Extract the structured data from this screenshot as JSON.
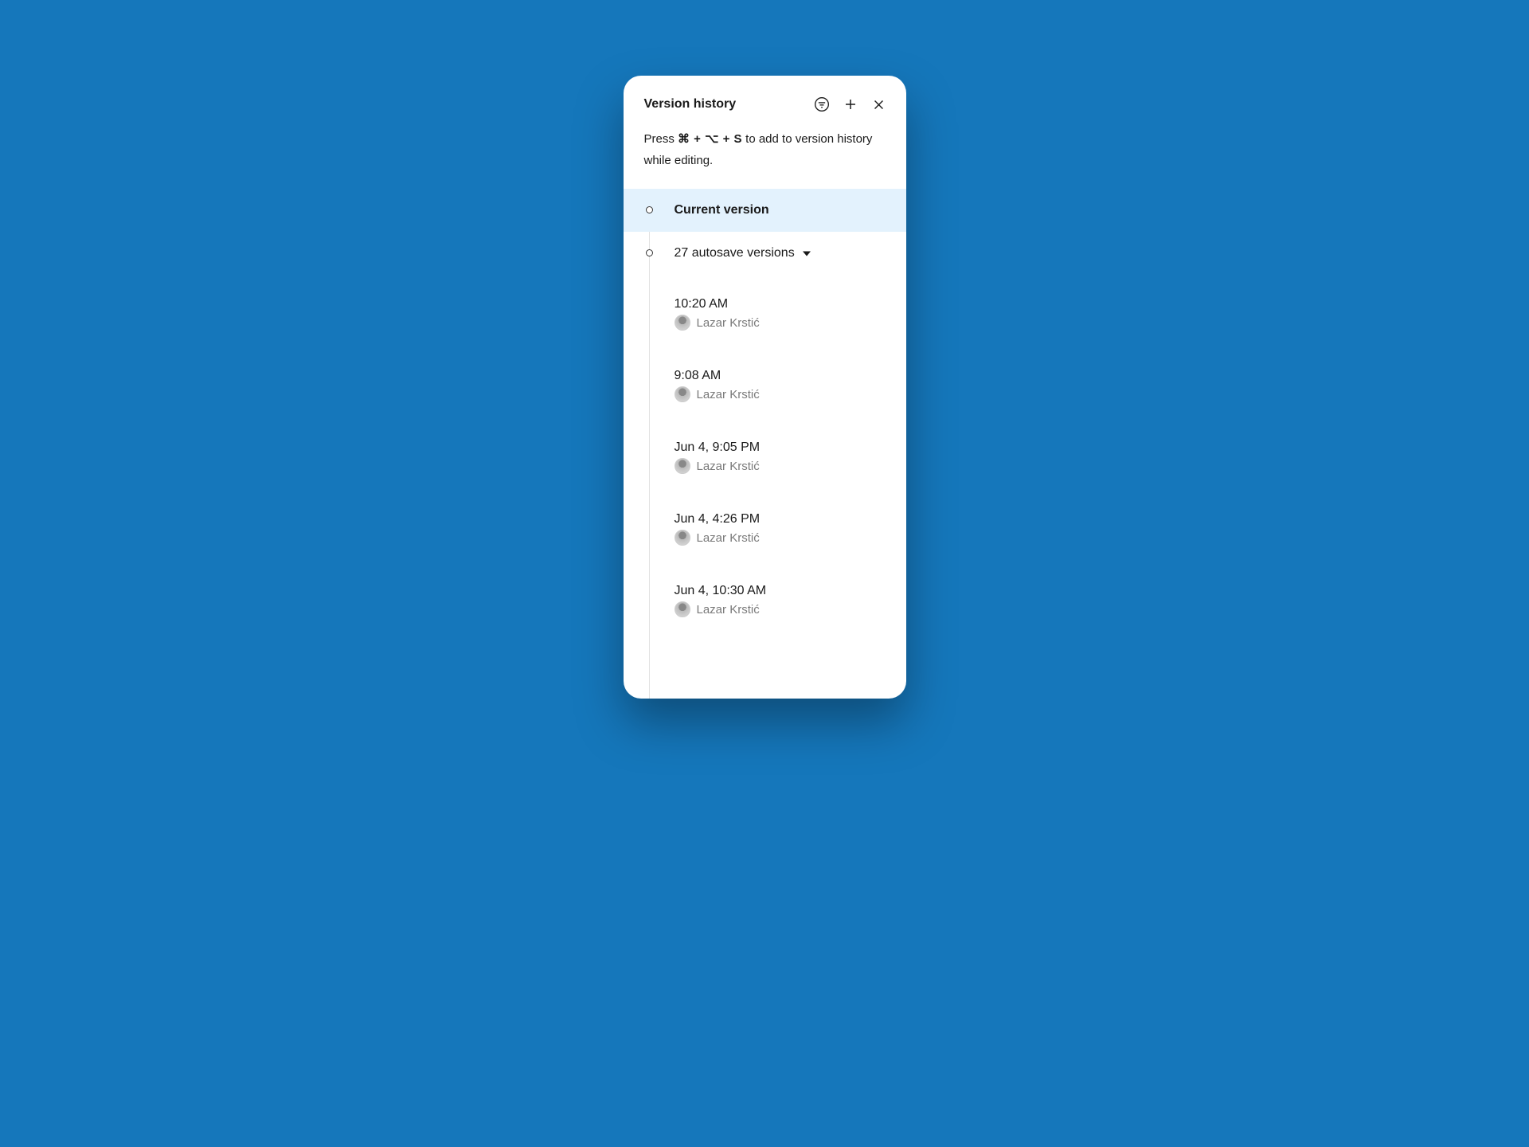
{
  "header": {
    "title": "Version history"
  },
  "hint": {
    "prefix": "Press ",
    "shortcut": "⌘ + ⌥ + S",
    "suffix": " to add to version history while editing."
  },
  "current": {
    "label": "Current version"
  },
  "autosave": {
    "label": "27 autosave versions"
  },
  "versions": [
    {
      "time": "10:20 AM",
      "user": "Lazar Krstić"
    },
    {
      "time": "9:08 AM",
      "user": "Lazar Krstić"
    },
    {
      "time": "Jun 4, 9:05 PM",
      "user": "Lazar Krstić"
    },
    {
      "time": "Jun 4, 4:26 PM",
      "user": "Lazar Krstić"
    },
    {
      "time": "Jun 4, 10:30 AM",
      "user": "Lazar Krstić"
    }
  ]
}
